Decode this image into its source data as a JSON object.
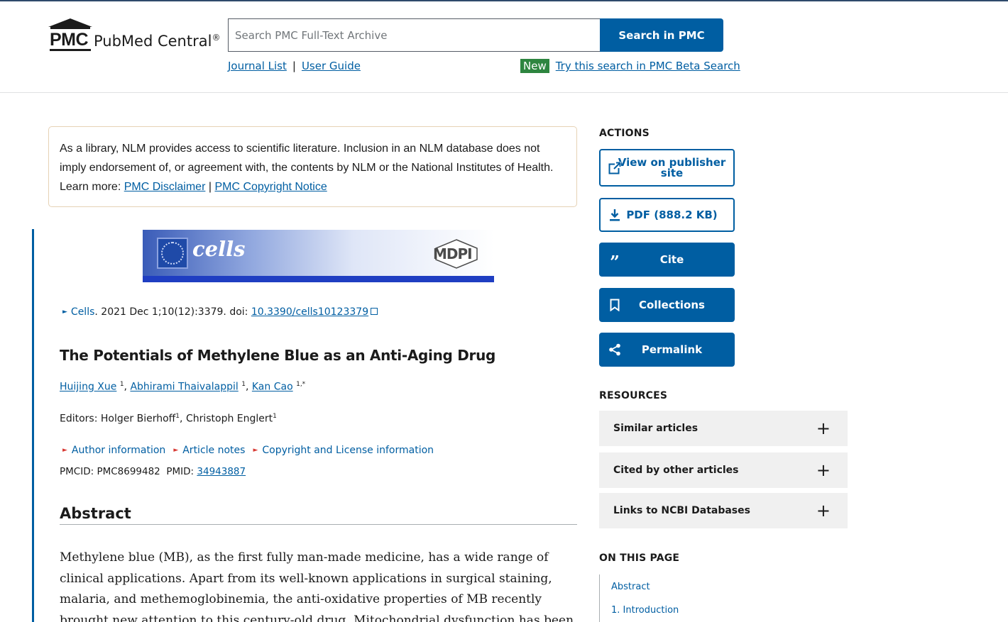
{
  "header": {
    "logo_text": "PubMed Central",
    "logo_abbrev": "PMC",
    "logo_reg": "®",
    "search_placeholder": "Search PMC Full-Text Archive",
    "search_button": "Search in PMC",
    "journal_list": "Journal List",
    "separator": "|",
    "user_guide": "User Guide",
    "new_badge": "New",
    "beta_link": "Try this search in PMC Beta Search"
  },
  "disclaimer": {
    "text": "As a library, NLM provides access to scientific literature. Inclusion in an NLM database does not imply endorsement of, or agreement with, the contents by NLM or the National Institutes of Health.",
    "learn_more": "Learn more:",
    "link1": "PMC Disclaimer",
    "sep": "|",
    "link2": "PMC Copyright Notice"
  },
  "banner": {
    "journal": "cells",
    "publisher": "MDPI"
  },
  "citation": {
    "journal": "Cells",
    "details": ". 2021 Dec 1;10(12):3379. doi: ",
    "doi": "10.3390/cells10123379"
  },
  "article": {
    "title": "The Potentials of Methylene Blue as an Anti-Aging Drug",
    "authors": [
      {
        "name": "Huijing Xue",
        "sup": "1"
      },
      {
        "name": "Abhirami Thaivalappil",
        "sup": "1"
      },
      {
        "name": "Kan Cao",
        "sup": "1,*"
      }
    ],
    "editors_label": "Editors: ",
    "editor1": "Holger Bierhoff",
    "editor1_sup": "1",
    "editor2": "Christoph Englert",
    "editor2_sup": "1",
    "info_links": [
      "Author information",
      "Article notes",
      "Copyright and License information"
    ],
    "pmcid_label": "PMCID: ",
    "pmcid": "PMC8699482",
    "pmid_label": "PMID: ",
    "pmid": "34943887",
    "abstract_heading": "Abstract",
    "abstract_text": "Methylene blue (MB), as the first fully man-made medicine, has a wide range of clinical applications. Apart from its well-known applications in surgical staining, malaria, and methemoglobinemia, the anti-oxidative properties of MB recently brought new attention to this century-old drug. Mitochondrial dysfunction has been observed in systematic aging that"
  },
  "sidebar": {
    "actions_label": "ACTIONS",
    "view_publisher": "View on publisher site",
    "pdf": "PDF (888.2 KB)",
    "cite": "Cite",
    "collections": "Collections",
    "permalink": "Permalink",
    "resources_label": "RESOURCES",
    "resources": [
      "Similar articles",
      "Cited by other articles",
      "Links to NCBI Databases"
    ],
    "plus_symbol": "+",
    "on_this_page_label": "ON THIS PAGE",
    "on_this_page": [
      "Abstract",
      "1. Introduction"
    ]
  },
  "colors": {
    "primary": "#005ea2",
    "new_badge": "#2e8540",
    "accent_red": "#d83933"
  }
}
